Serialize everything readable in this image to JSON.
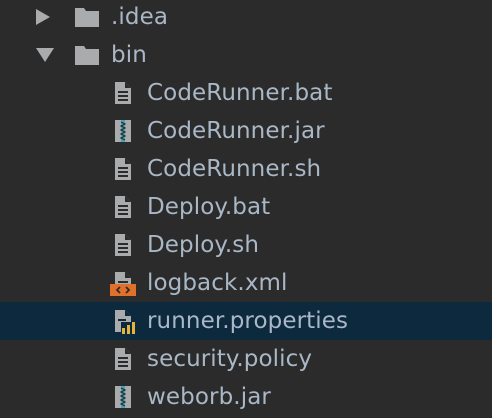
{
  "tree": {
    "items": [
      {
        "label": ".idea",
        "kind": "folder",
        "icon": "folder-icon",
        "expanded": false,
        "level": 0
      },
      {
        "label": "bin",
        "kind": "folder",
        "icon": "folder-icon",
        "expanded": true,
        "level": 0
      },
      {
        "label": "CodeRunner.bat",
        "kind": "file",
        "icon": "text-file-icon",
        "level": 1
      },
      {
        "label": "CodeRunner.jar",
        "kind": "file",
        "icon": "archive-file-icon",
        "level": 1
      },
      {
        "label": "CodeRunner.sh",
        "kind": "file",
        "icon": "text-file-icon",
        "level": 1
      },
      {
        "label": "Deploy.bat",
        "kind": "file",
        "icon": "text-file-icon",
        "level": 1
      },
      {
        "label": "Deploy.sh",
        "kind": "file",
        "icon": "text-file-icon",
        "level": 1
      },
      {
        "label": "logback.xml",
        "kind": "file",
        "icon": "xml-file-icon",
        "level": 1
      },
      {
        "label": "runner.properties",
        "kind": "file",
        "icon": "properties-file-icon",
        "level": 1,
        "selected": true
      },
      {
        "label": "security.policy",
        "kind": "file",
        "icon": "text-file-icon",
        "level": 1
      },
      {
        "label": "weborb.jar",
        "kind": "file",
        "icon": "archive-file-icon",
        "level": 1
      }
    ]
  },
  "colors": {
    "background": "#2b2b2b",
    "selection": "#0d293e",
    "text": "#a9b7c6",
    "icon_gray": "#a9abad",
    "xml_accent": "#e0702a",
    "jar_accent": "#40a6c0",
    "properties_accent": "#e5b43a"
  }
}
